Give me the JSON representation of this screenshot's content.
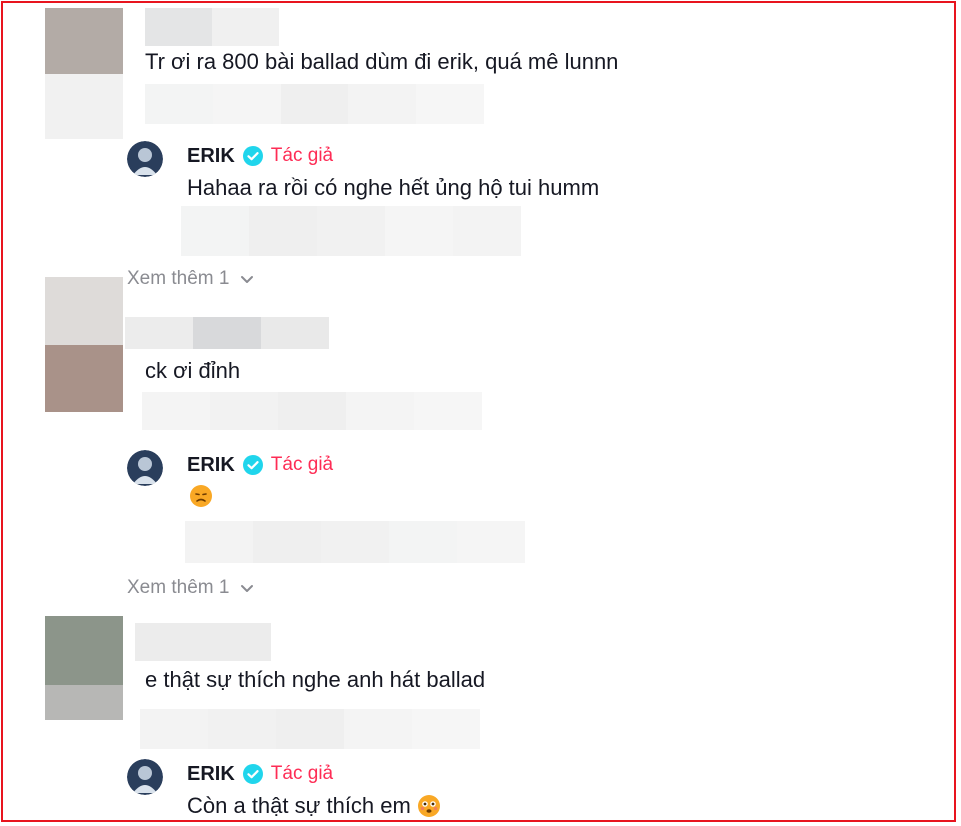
{
  "theme": {
    "accent": "#fe2c55",
    "verified": "#20d5ec",
    "frame": "#e8141e",
    "muted": "#8a8b91"
  },
  "threads": [
    {
      "comment": "Tr ơi ra 800 bài ballad dùm đi erik, quá mê lunnn",
      "reply": {
        "author": "ERIK",
        "badge": "Tác giả",
        "text": "Hahaa ra rồi có nghe hết ủng hộ tui humm"
      },
      "view_more": "Xem thêm 1"
    },
    {
      "comment": "ck ơi đỉnh",
      "reply": {
        "author": "ERIK",
        "badge": "Tác giả",
        "text": "",
        "emoji": "disappointed-face-icon"
      },
      "view_more": "Xem thêm 1"
    },
    {
      "comment": "e thật sự thích nghe anh hát ballad",
      "reply": {
        "author": "ERIK",
        "badge": "Tác giả",
        "text": "Còn a thật sự thích em",
        "emoji": "flushed-face-icon"
      }
    }
  ]
}
